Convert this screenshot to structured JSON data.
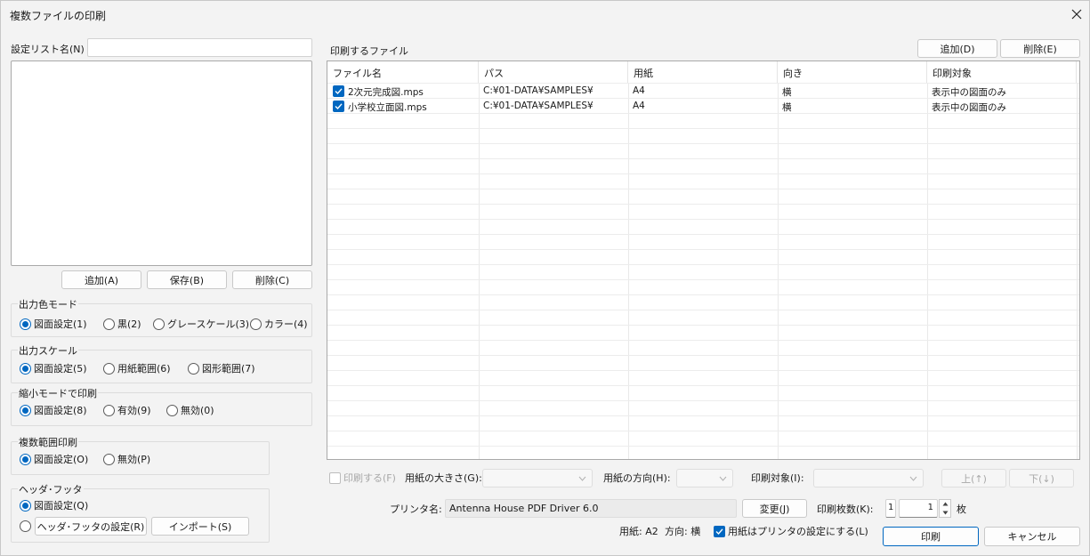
{
  "window": {
    "title": "複数ファイルの印刷"
  },
  "left": {
    "list_name_label": "設定リスト名(N)",
    "list_name_value": "",
    "buttons": {
      "add": "追加(A)",
      "save": "保存(B)",
      "delete": "削除(C)"
    }
  },
  "color_mode": {
    "title": "出力色モード",
    "options": [
      "図面設定(1)",
      "黒(2)",
      "グレースケール(3)",
      "カラー(4)"
    ],
    "selected": "図面設定(1)"
  },
  "output_scale": {
    "title": "出力スケール",
    "options": [
      "図面設定(5)",
      "用紙範囲(6)",
      "図形範囲(7)"
    ],
    "selected": "図面設定(5)"
  },
  "shrink_mode": {
    "title": "縮小モードで印刷",
    "options": [
      "図面設定(8)",
      "有効(9)",
      "無効(0)"
    ],
    "selected": "図面設定(8)"
  },
  "multi_range": {
    "title": "複数範囲印刷",
    "options": [
      "図面設定(O)",
      "無効(P)"
    ],
    "selected": "図面設定(O)"
  },
  "header_footer": {
    "title": "ヘッダ･フッタ",
    "option1": "図面設定(Q)",
    "settings_button": "ヘッダ･フッタの設定(R)",
    "import_button": "インポート(S)"
  },
  "files": {
    "section_label": "印刷するファイル",
    "add_button": "追加(D)",
    "delete_button": "削除(E)",
    "columns": [
      "ファイル名",
      "パス",
      "用紙",
      "向き",
      "印刷対象"
    ],
    "rows": [
      {
        "checked": true,
        "name": "2次元完成図.mps",
        "path": "C:¥01-DATA¥SAMPLES¥",
        "paper": "A4",
        "orientation": "横",
        "target": "表示中の図面のみ"
      },
      {
        "checked": true,
        "name": "小学校立面図.mps",
        "path": "C:¥01-DATA¥SAMPLES¥",
        "paper": "A4",
        "orientation": "横",
        "target": "表示中の図面のみ"
      }
    ]
  },
  "file_options": {
    "print_check": "印刷する(F)",
    "paper_size_label": "用紙の大きさ(G):",
    "paper_dir_label": "用紙の方向(H):",
    "print_target_label": "印刷対象(I):",
    "up_button": "上(↑)",
    "down_button": "下(↓)"
  },
  "printer": {
    "label": "プリンタ名:",
    "name": "Antenna House PDF Driver 6.0",
    "change_button": "変更(J)",
    "copies_label": "印刷枚数(K):",
    "copies_prefix": "1",
    "copies_value": "1",
    "copies_unit": "枚",
    "paper_info": "用紙: A2",
    "direction_info": "方向: 横",
    "use_printer_paper": "用紙はプリンタの設定にする(L)"
  },
  "footer": {
    "print_button": "印刷",
    "cancel_button": "キャンセル"
  },
  "colors": {
    "accent": "#0067c0",
    "background": "#f3f3f3"
  }
}
